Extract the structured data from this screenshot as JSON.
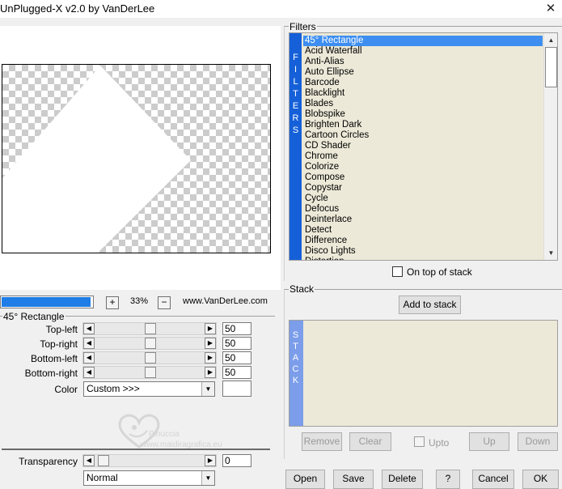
{
  "window": {
    "title": "UnPlugged-X v2.0 by VanDerLee",
    "close_glyph": "✕"
  },
  "zoom": {
    "plus": "+",
    "value": "33%",
    "minus": "−",
    "progress_fraction": 0.98
  },
  "site": "www.VanDerLee.com",
  "params": {
    "group_title": "45° Rectangle",
    "rows": [
      {
        "label": "Top-left",
        "value": "50"
      },
      {
        "label": "Top-right",
        "value": "50"
      },
      {
        "label": "Bottom-left",
        "value": "50"
      },
      {
        "label": "Bottom-right",
        "value": "50"
      }
    ],
    "color_label": "Color",
    "color_value": "Custom >>>",
    "transparency_label": "Transparency",
    "transparency_value": "0",
    "blend_value": "Normal"
  },
  "watermark": {
    "line1": "Pinuccia",
    "line2": "www.maidiragrafica.eu"
  },
  "filters": {
    "title": "Filters",
    "side_letters": [
      "F",
      "I",
      "L",
      "T",
      "E",
      "R",
      "S"
    ],
    "items": [
      "45° Rectangle",
      "Acid Waterfall",
      "Anti-Alias",
      "Auto Ellipse",
      "Barcode",
      "Blacklight",
      "Blades",
      "Blobspike",
      "Brighten Dark",
      "Cartoon Circles",
      "CD Shader",
      "Chrome",
      "Colorize",
      "Compose",
      "Copystar",
      "Cycle",
      "Defocus",
      "Deinterlace",
      "Detect",
      "Difference",
      "Disco Lights",
      "Distortion"
    ],
    "selected_index": 0,
    "on_top_label": "On top of stack"
  },
  "stack": {
    "title": "Stack",
    "add_label": "Add to stack",
    "side_letters": [
      "S",
      "T",
      "A",
      "C",
      "K"
    ],
    "remove_label": "Remove",
    "clear_label": "Clear",
    "upto_label": "Upto",
    "up_label": "Up",
    "down_label": "Down"
  },
  "footer": {
    "open": "Open",
    "save": "Save",
    "delete": "Delete",
    "help": "?",
    "cancel": "Cancel",
    "ok": "OK"
  },
  "colors": {
    "accent": "#1e7de6",
    "filter_side": "#1560d8",
    "stack_side": "#7b9dea",
    "list_bg": "#ece9d8",
    "selected": "#3d8ef0"
  },
  "icons": [
    "close-icon",
    "arrow-left-icon",
    "arrow-right-icon",
    "dropdown-arrow-icon",
    "scroll-up-icon",
    "scroll-down-icon",
    "watermark-heart-icon"
  ]
}
